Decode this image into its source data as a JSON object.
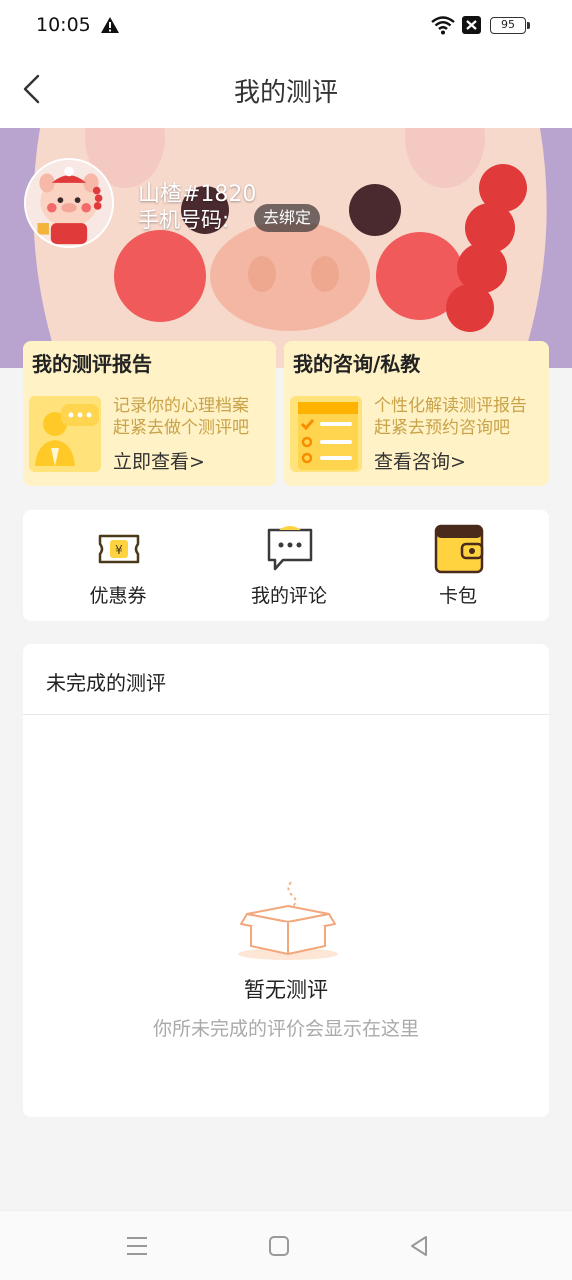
{
  "status_bar": {
    "time": "10:05",
    "battery": "95",
    "icons": [
      "warning-icon",
      "wifi-icon",
      "no-sim-icon",
      "battery-icon"
    ]
  },
  "nav": {
    "title": "我的测评",
    "back_icon": "chevron-left-icon"
  },
  "profile": {
    "username": "山楂#1820",
    "phone_label": "手机号码:",
    "unbind_label": "去绑定"
  },
  "cards": {
    "report": {
      "title": "我的测评报告",
      "desc_line1": "记录你的心理档案",
      "desc_line2": "赶紧去做个测评吧",
      "link": "立即查看>"
    },
    "consult": {
      "title": "我的咨询/私教",
      "desc_line1": "个性化解读测评报告",
      "desc_line2": "赶紧去预约咨询吧",
      "link": "查看咨询>"
    }
  },
  "tools": [
    {
      "label": "优惠券",
      "icon": "coupon-icon"
    },
    {
      "label": "我的评论",
      "icon": "comment-icon"
    },
    {
      "label": "卡包",
      "icon": "wallet-icon"
    }
  ],
  "pending": {
    "title": "未完成的测评",
    "empty_title": "暂无测评",
    "empty_desc": "你所未完成的评价会显示在这里",
    "empty_icon": "empty-box-icon"
  },
  "colors": {
    "accent_yellow": "#ffd23f",
    "card_bg": "#fff2c6",
    "desc_text": "#c9a34a",
    "hero_purple": "#b9a3cf",
    "hero_pink": "#f6dcd2"
  }
}
